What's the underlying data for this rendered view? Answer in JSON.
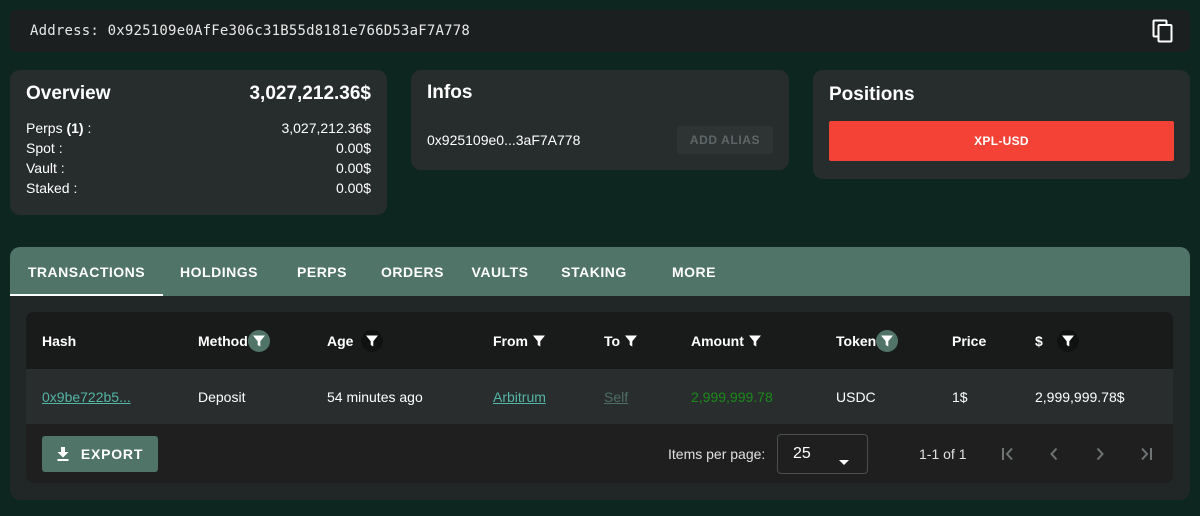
{
  "address_bar": {
    "text": "Address: 0x925109e0AfFe306c31B55d8181e766D53aF7A778",
    "copy_icon": "copy-icon"
  },
  "overview": {
    "title": "Overview",
    "total": "3,027,212.36$",
    "rows": [
      {
        "label_prefix": "Perps ",
        "label_bold": "(1)",
        "label_suffix": " :",
        "value": "3,027,212.36$"
      },
      {
        "label_prefix": "Spot :",
        "label_bold": "",
        "label_suffix": "",
        "value": "0.00$"
      },
      {
        "label_prefix": "Vault :",
        "label_bold": "",
        "label_suffix": "",
        "value": "0.00$"
      },
      {
        "label_prefix": "Staked :",
        "label_bold": "",
        "label_suffix": "",
        "value": "0.00$"
      }
    ]
  },
  "infos": {
    "title": "Infos",
    "short_address": "0x925109e0...3aF7A778",
    "add_alias_label": "ADD ALIAS"
  },
  "positions": {
    "title": "Positions",
    "items": [
      {
        "label": "XPL-USD",
        "color": "#f44336"
      }
    ]
  },
  "tabs": [
    {
      "label": "TRANSACTIONS",
      "active": true
    },
    {
      "label": "HOLDINGS",
      "active": false
    },
    {
      "label": "PERPS",
      "active": false
    },
    {
      "label": "ORDERS",
      "active": false
    },
    {
      "label": "VAULTS",
      "active": false
    },
    {
      "label": "STAKING",
      "active": false
    },
    {
      "label": "MORE",
      "active": false
    }
  ],
  "table": {
    "columns": [
      {
        "label": "Hash",
        "filter": "none"
      },
      {
        "label": "Method",
        "filter": "active"
      },
      {
        "label": "Age",
        "filter": "dark"
      },
      {
        "label": "From",
        "filter": "plain"
      },
      {
        "label": "To",
        "filter": "plain"
      },
      {
        "label": "Amount",
        "filter": "plain"
      },
      {
        "label": "Token",
        "filter": "active"
      },
      {
        "label": "Price",
        "filter": "none"
      },
      {
        "label": "$",
        "filter": "dark"
      }
    ],
    "rows": [
      {
        "hash": "0x9be722b5...",
        "method": "Deposit",
        "age": "54 minutes ago",
        "from": "Arbitrum",
        "to": "Self",
        "amount": "2,999,999.78",
        "token": "USDC",
        "price": "1$",
        "usd": "2,999,999.78$"
      }
    ]
  },
  "footer": {
    "export_label": "EXPORT",
    "items_per_page_label": "Items per page:",
    "items_per_page_value": "25",
    "range_label": "1-1 of 1"
  },
  "colors": {
    "background": "#0e2620",
    "card": "#272c2c",
    "accent": "#517468",
    "position_red": "#f44336",
    "link_teal": "#53b5a6",
    "amount_green": "#1b8a1b"
  }
}
